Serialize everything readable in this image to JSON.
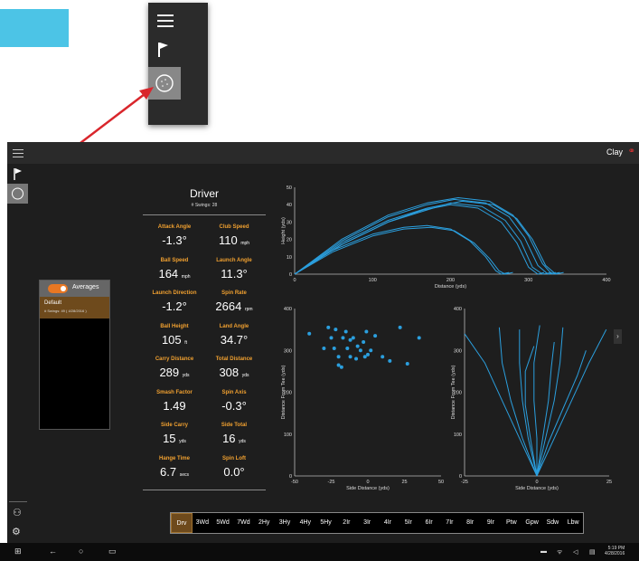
{
  "app": {
    "user": "Clay"
  },
  "club": {
    "name": "Driver",
    "swings": "# Swings: 28"
  },
  "averages": {
    "label": "Averages",
    "default_name": "Default",
    "default_sub": "# Swings: 49   ( 4/28/2016 )"
  },
  "metrics": [
    {
      "label": "Attack Angle",
      "value": "-1.3°",
      "unit": ""
    },
    {
      "label": "Club Speed",
      "value": "110",
      "unit": "mph"
    },
    {
      "label": "Ball Speed",
      "value": "164",
      "unit": "mph"
    },
    {
      "label": "Launch Angle",
      "value": "11.3°",
      "unit": ""
    },
    {
      "label": "Launch Direction",
      "value": "-1.2°",
      "unit": ""
    },
    {
      "label": "Spin Rate",
      "value": "2664",
      "unit": "rpm"
    },
    {
      "label": "Ball Height",
      "value": "105",
      "unit": "ft"
    },
    {
      "label": "Land Angle",
      "value": "34.7°",
      "unit": ""
    },
    {
      "label": "Carry Distance",
      "value": "289",
      "unit": "yds"
    },
    {
      "label": "Total Distance",
      "value": "308",
      "unit": "yds"
    },
    {
      "label": "Smash Factor",
      "value": "1.49",
      "unit": ""
    },
    {
      "label": "Spin Axis",
      "value": "-0.3°",
      "unit": ""
    },
    {
      "label": "Side Carry",
      "value": "15",
      "unit": "yds"
    },
    {
      "label": "Side Total",
      "value": "16",
      "unit": "yds"
    },
    {
      "label": "Hange Time",
      "value": "6.7",
      "unit": "secs"
    },
    {
      "label": "Spin Loft",
      "value": "0.0°",
      "unit": ""
    }
  ],
  "clubs": [
    "Drv",
    "3Wd",
    "5Wd",
    "7Wd",
    "2Hy",
    "3Hy",
    "4Hy",
    "5Hy",
    "2Ir",
    "3Ir",
    "4Ir",
    "5Ir",
    "6Ir",
    "7Ir",
    "8Ir",
    "9Ir",
    "Ptw",
    "Gpw",
    "Sdw",
    "Lbw"
  ],
  "active_club": "Drv",
  "taskbar": {
    "time": "5:19 PM",
    "date": "4/28/2016"
  },
  "icons": {
    "menu": "hamburger-icon",
    "flag": "flag-icon",
    "ball": "golf-ball-icon",
    "users": "users-icon",
    "settings": "gear-icon",
    "profile": "profile-icon"
  },
  "colors": {
    "accent": "#e87722",
    "chart_line": "#2b9fde",
    "metric_label": "#f0a030",
    "callout": "#4cc4e6",
    "arrow": "#d9262c"
  },
  "chart_data": [
    {
      "type": "line",
      "title": "",
      "xlabel": "Distance (yds)",
      "ylabel": "Height (yds)",
      "xlim": [
        0,
        400
      ],
      "ylim": [
        0,
        50
      ],
      "xticks": [
        0,
        100,
        200,
        300,
        400
      ],
      "yticks": [
        0,
        10,
        20,
        30,
        40,
        50
      ],
      "series": [
        {
          "x": [
            0,
            60,
            120,
            170,
            210,
            250,
            280,
            300,
            318,
            330,
            340
          ],
          "y": [
            0,
            20,
            34,
            41,
            44,
            42,
            34,
            22,
            6,
            0,
            1
          ]
        },
        {
          "x": [
            0,
            60,
            120,
            170,
            205,
            245,
            275,
            295,
            312,
            325,
            335
          ],
          "y": [
            0,
            19,
            33,
            40,
            43,
            41,
            33,
            21,
            5,
            0,
            1
          ]
        },
        {
          "x": [
            0,
            60,
            120,
            170,
            215,
            255,
            285,
            305,
            322,
            335,
            345
          ],
          "y": [
            0,
            18,
            31,
            38,
            42,
            40,
            32,
            20,
            5,
            0,
            1
          ]
        },
        {
          "x": [
            0,
            60,
            120,
            170,
            200,
            240,
            270,
            290,
            305,
            318,
            330
          ],
          "y": [
            0,
            17,
            30,
            37,
            41,
            39,
            31,
            19,
            4,
            0,
            1
          ]
        },
        {
          "x": [
            0,
            60,
            120,
            165,
            200,
            235,
            265,
            285,
            300,
            312,
            320
          ],
          "y": [
            0,
            17,
            30,
            37,
            40,
            38,
            30,
            18,
            4,
            0,
            1
          ]
        },
        {
          "x": [
            0,
            50,
            100,
            140,
            170,
            200,
            225,
            245,
            258,
            265,
            275
          ],
          "y": [
            0,
            14,
            23,
            27,
            28,
            26,
            19,
            10,
            2,
            0,
            1
          ]
        },
        {
          "x": [
            0,
            50,
            100,
            140,
            175,
            205,
            230,
            250,
            262,
            270,
            280
          ],
          "y": [
            0,
            13,
            22,
            26,
            27,
            25,
            18,
            9,
            2,
            0,
            1
          ]
        }
      ]
    },
    {
      "type": "scatter",
      "title": "",
      "xlabel": "Side Distance (yds)",
      "ylabel": "Distance From Tee (yds)",
      "xlim": [
        -50,
        50
      ],
      "ylim": [
        0,
        400
      ],
      "xticks": [
        -50,
        -25,
        0,
        25,
        50
      ],
      "yticks": [
        0,
        100,
        200,
        300,
        400
      ],
      "points": [
        [
          -40,
          340
        ],
        [
          -30,
          305
        ],
        [
          -27,
          355
        ],
        [
          -25,
          330
        ],
        [
          -23,
          305
        ],
        [
          -22,
          350
        ],
        [
          -20,
          265
        ],
        [
          -20,
          285
        ],
        [
          -18,
          260
        ],
        [
          -17,
          330
        ],
        [
          -15,
          345
        ],
        [
          -14,
          305
        ],
        [
          -12,
          285
        ],
        [
          -12,
          325
        ],
        [
          -10,
          330
        ],
        [
          -8,
          280
        ],
        [
          -7,
          310
        ],
        [
          -5,
          300
        ],
        [
          -3,
          320
        ],
        [
          -2,
          285
        ],
        [
          -1,
          345
        ],
        [
          0,
          290
        ],
        [
          2,
          300
        ],
        [
          5,
          335
        ],
        [
          10,
          285
        ],
        [
          15,
          275
        ],
        [
          22,
          355
        ],
        [
          27,
          268
        ],
        [
          35,
          330
        ]
      ]
    },
    {
      "type": "line",
      "title": "",
      "xlabel": "Side Distance (yds)",
      "ylabel": "Distance From Tee (yds)",
      "xlim": [
        -25,
        25
      ],
      "ylim": [
        0,
        400
      ],
      "xticks": [
        -25,
        0,
        25
      ],
      "yticks": [
        0,
        100,
        200,
        300,
        400
      ],
      "series": [
        {
          "x": [
            0,
            -6,
            -12,
            -18,
            -25
          ],
          "y": [
            0,
            90,
            180,
            270,
            340
          ]
        },
        {
          "x": [
            0,
            -5,
            -9,
            -12,
            -13
          ],
          "y": [
            0,
            90,
            180,
            270,
            355
          ]
        },
        {
          "x": [
            0,
            -3,
            -5,
            -6,
            -6
          ],
          "y": [
            0,
            90,
            180,
            270,
            350
          ]
        },
        {
          "x": [
            0,
            -2,
            -4,
            -4,
            -1
          ],
          "y": [
            0,
            80,
            170,
            250,
            310
          ]
        },
        {
          "x": [
            0,
            0,
            -1,
            -1,
            1
          ],
          "y": [
            0,
            90,
            180,
            270,
            360
          ]
        },
        {
          "x": [
            0,
            2,
            4,
            5,
            6
          ],
          "y": [
            0,
            90,
            180,
            260,
            320
          ]
        },
        {
          "x": [
            0,
            3,
            6,
            8,
            9
          ],
          "y": [
            0,
            90,
            180,
            270,
            355
          ]
        },
        {
          "x": [
            0,
            4,
            9,
            14,
            17
          ],
          "y": [
            0,
            80,
            160,
            240,
            300
          ]
        },
        {
          "x": [
            0,
            6,
            12,
            18,
            24
          ],
          "y": [
            0,
            90,
            180,
            270,
            350
          ]
        }
      ]
    }
  ]
}
